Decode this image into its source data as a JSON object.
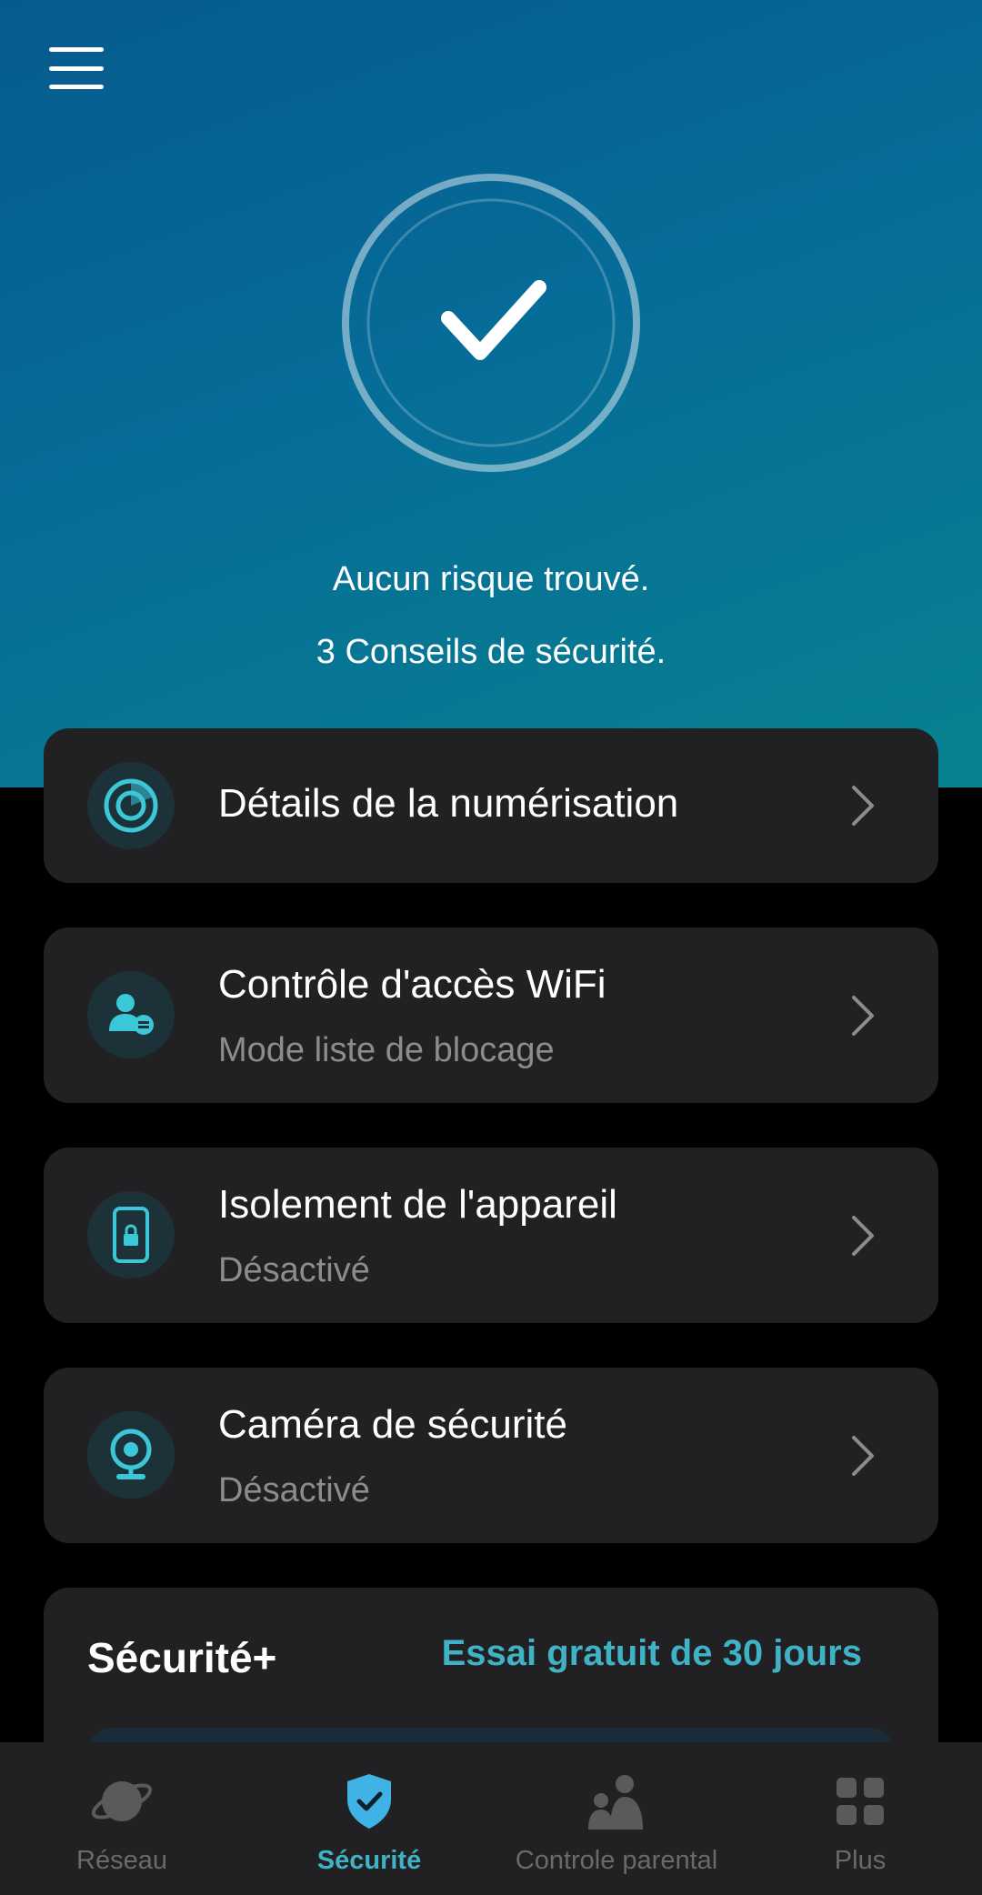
{
  "header": {
    "menu_icon": "hamburger-menu-icon",
    "status_icon": "checkmark-circle-icon"
  },
  "status": {
    "line1": "Aucun risque trouvé.",
    "line2": "3 Conseils de sécurité."
  },
  "cards": [
    {
      "title": "Détails de la numérisation",
      "subtitle": "",
      "icon": "radar-scan-icon"
    },
    {
      "title": "Contrôle d'accès WiFi",
      "subtitle": "Mode liste de blocage",
      "icon": "user-list-icon"
    },
    {
      "title": "Isolement de l'appareil",
      "subtitle": "Désactivé",
      "icon": "phone-lock-icon"
    },
    {
      "title": "Caméra de sécurité",
      "subtitle": "Désactivé",
      "icon": "webcam-icon"
    }
  ],
  "security_plus": {
    "title": "Sécurité+",
    "trial_link": "Essai gratuit de 30 jours"
  },
  "bottom_nav": [
    {
      "label": "Réseau",
      "icon": "planet-icon",
      "active": false
    },
    {
      "label": "Sécurité",
      "icon": "shield-check-icon",
      "active": true
    },
    {
      "label": "Controle parental",
      "icon": "family-icon",
      "active": false
    },
    {
      "label": "Plus",
      "icon": "grid-icon",
      "active": false
    }
  ],
  "colors": {
    "accent": "#3fb2c6",
    "card_background": "#212123",
    "hero_gradient_start": "#065a8f",
    "hero_gradient_end": "#08828f",
    "inactive": "#6a6a6c"
  }
}
